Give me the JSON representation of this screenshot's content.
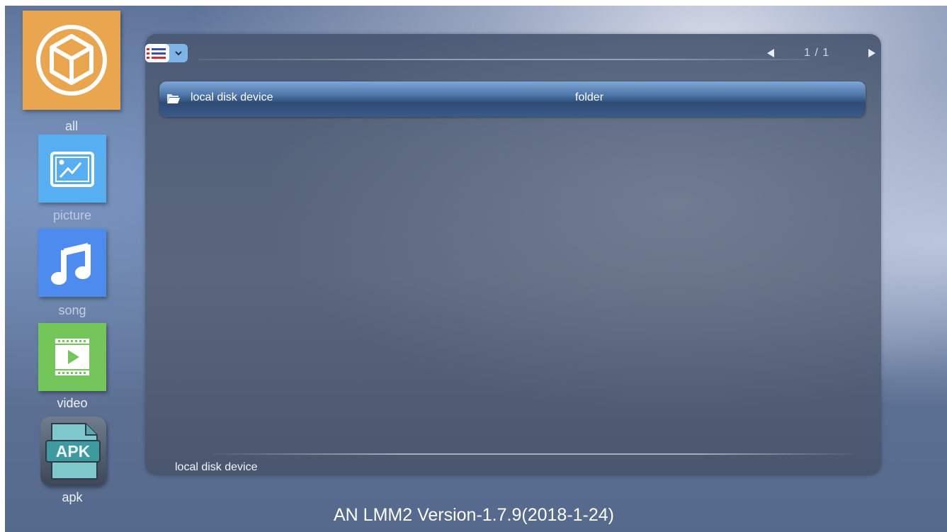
{
  "sidebar": {
    "items": [
      {
        "label": "all",
        "icon": "package-icon",
        "color": "#eaa54f",
        "selected": true
      },
      {
        "label": "picture",
        "icon": "picture-icon",
        "color": "#57aff2"
      },
      {
        "label": "song",
        "icon": "music-note-icon",
        "color": "#4d8cee"
      },
      {
        "label": "video",
        "icon": "film-play-icon",
        "color": "#74c65a"
      },
      {
        "label": "apk",
        "icon": "apk-file-icon",
        "icon_text": "APK"
      }
    ]
  },
  "toolbar": {
    "view_mode_icon": "list-view-icon",
    "view_mode_dropdown_icon": "chevron-down-icon"
  },
  "pager": {
    "prev_icon": "triangle-left-icon",
    "text": "1 / 1",
    "next_icon": "triangle-right-icon"
  },
  "files": [
    {
      "name": "local disk device",
      "type": "folder",
      "icon": "folder-icon",
      "selected": true
    }
  ],
  "status": {
    "path": "local disk device"
  },
  "footer": {
    "version": "AN LMM2 Version-1.7.9(2018-1-24)"
  }
}
